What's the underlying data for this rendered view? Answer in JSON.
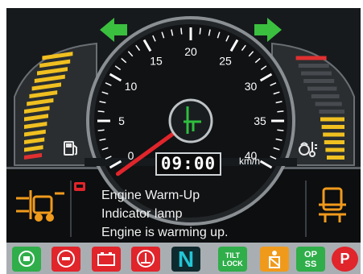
{
  "speedometer": {
    "unit": "km/h",
    "ticks": [
      "0",
      "5",
      "10",
      "15",
      "20",
      "25",
      "30",
      "35",
      "40"
    ],
    "needle_value_kmh": 0,
    "needle_color": "#e0252b"
  },
  "clock": {
    "time": "09:00"
  },
  "turn_signals": {
    "left": {
      "icon": "arrow-left-icon",
      "color": "#3bbf3f"
    },
    "right": {
      "icon": "arrow-right-icon",
      "color": "#3bbf3f"
    }
  },
  "fuel_gauge": {
    "icon": "fuel-pump-icon",
    "segments_total": 14,
    "segments_lit": 14,
    "colors": {
      "low": "#e03030",
      "normal": "#f0c020"
    }
  },
  "temp_gauge": {
    "icon": "coolant-temperature-icon",
    "segments_total": 14,
    "segments_lit": 6,
    "colors": {
      "lit": "#f0c020",
      "unlit": "#474b4f",
      "high": "#e03030"
    }
  },
  "message": {
    "warning_icon": "engine-warm-up-small-icon",
    "lines": [
      "Engine Warm-Up",
      "Indicator lamp",
      "Engine is warming up."
    ]
  },
  "forklift_indicators": {
    "left": "forklift-side-view-icon",
    "right": "forklift-front-view-icon",
    "color": "#f09a1c"
  },
  "indicator_bar": {
    "items": [
      {
        "name": "engine-warm-up-indicator",
        "icon": "engine-warm-up-icon",
        "color": "#2fae4a"
      },
      {
        "name": "brake-indicator",
        "icon": "brake-icon",
        "color": "#e0252b"
      },
      {
        "name": "battery-indicator",
        "icon": "battery-icon",
        "color": "#e0252b"
      },
      {
        "name": "oil-pressure-indicator",
        "icon": "oil-pressure-icon",
        "color": "#e0252b"
      },
      {
        "name": "neutral-indicator",
        "icon": "neutral-icon",
        "text": "N",
        "color": "#22c6d6"
      },
      {
        "name": "tilt-lock-indicator",
        "icon": "tilt-lock-icon",
        "text": "TILT LOCK",
        "color": "#2fae4a"
      },
      {
        "name": "seat-belt-indicator",
        "icon": "seat-belt-icon",
        "color": "#f09a1c"
      },
      {
        "name": "ops-indicator",
        "icon": "ops-icon",
        "text": "OP SS",
        "color": "#2fae4a"
      },
      {
        "name": "parking-brake-indicator",
        "icon": "parking-brake-icon",
        "text": "P",
        "color": "#e0252b"
      }
    ]
  }
}
